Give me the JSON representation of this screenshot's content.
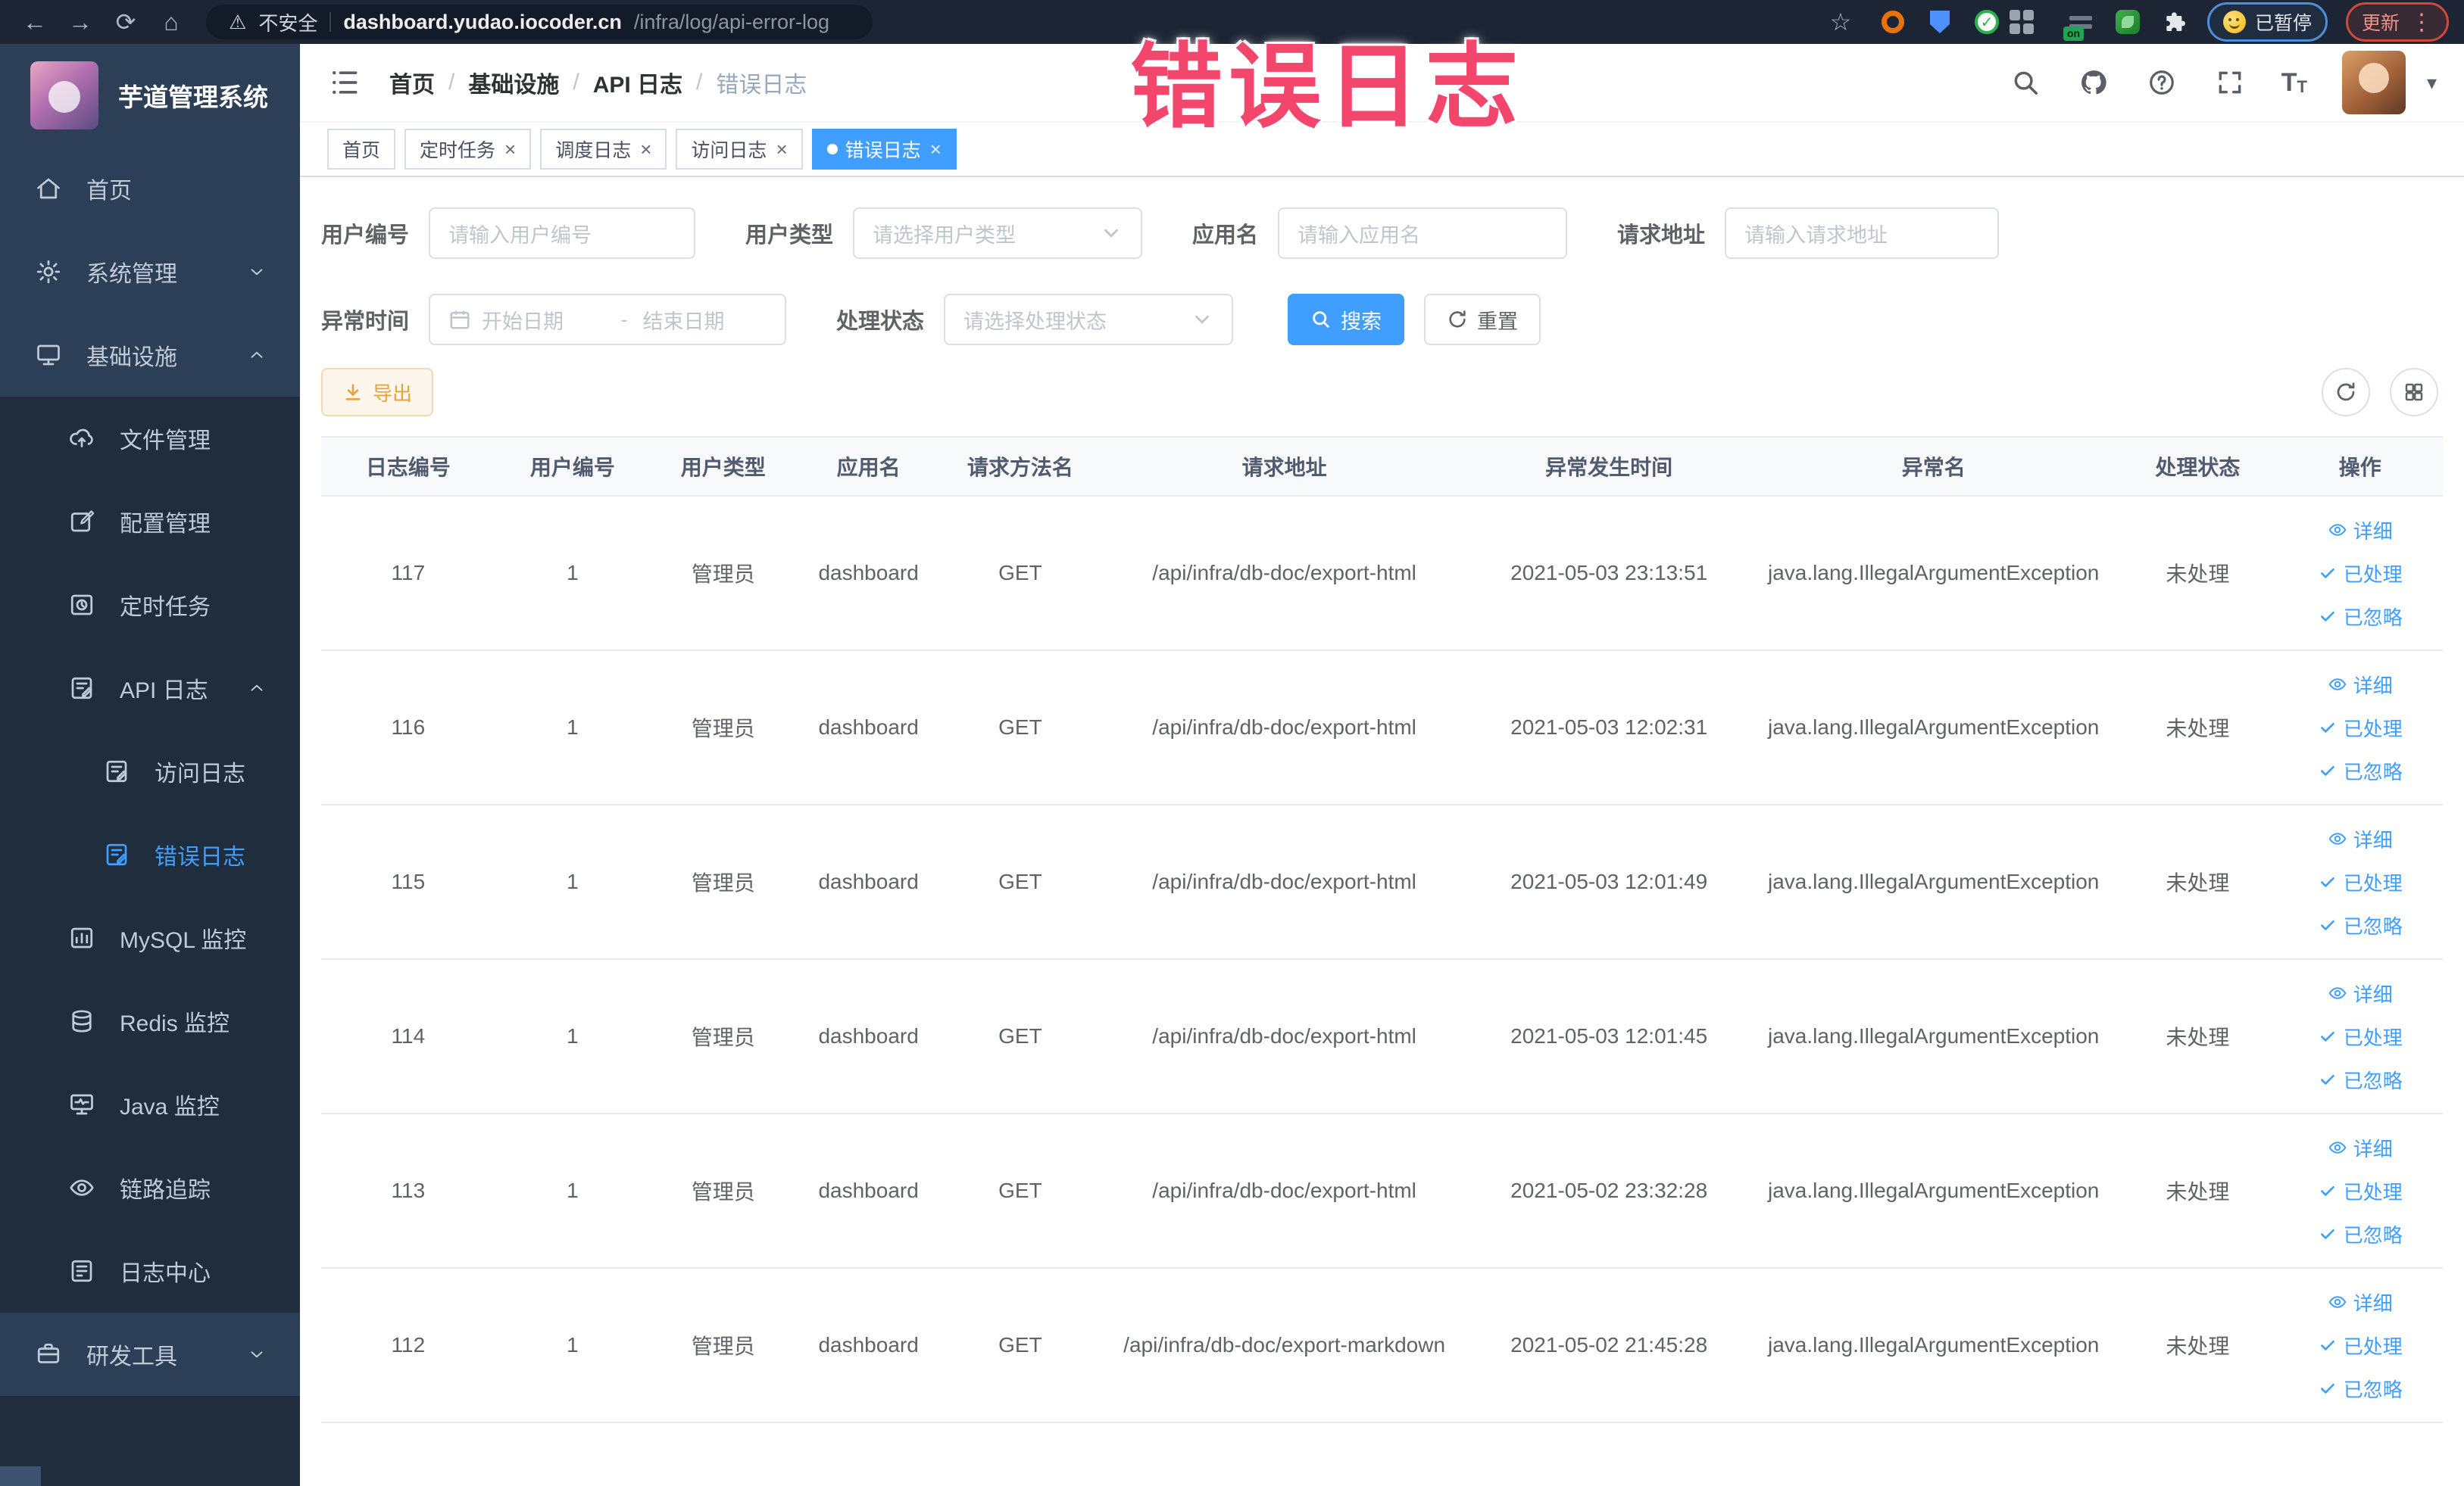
{
  "browser": {
    "security_label": "不安全",
    "url_domain": "dashboard.yudao.iocoder.cn",
    "url_path": "/infra/log/api-error-log",
    "extension_badge": "on",
    "paused_label": "已暂停",
    "update_label": "更新"
  },
  "annotation": {
    "text": "错误日志",
    "color": "#f2466c"
  },
  "sidebar": {
    "app_title": "芋道管理系统",
    "items": [
      {
        "label": "首页",
        "icon": "home-icon",
        "level": 0,
        "sub": false,
        "arrow": null,
        "active": false
      },
      {
        "label": "系统管理",
        "icon": "gear-icon",
        "level": 0,
        "sub": false,
        "arrow": "down",
        "active": false
      },
      {
        "label": "基础设施",
        "icon": "infrastructure-icon",
        "level": 0,
        "sub": false,
        "arrow": "up",
        "active": false
      },
      {
        "label": "文件管理",
        "icon": "file-upload-icon",
        "level": 1,
        "sub": true,
        "arrow": null,
        "active": false
      },
      {
        "label": "配置管理",
        "icon": "config-edit-icon",
        "level": 1,
        "sub": true,
        "arrow": null,
        "active": false
      },
      {
        "label": "定时任务",
        "icon": "schedule-icon",
        "level": 1,
        "sub": true,
        "arrow": null,
        "active": false
      },
      {
        "label": "API 日志",
        "icon": "api-log-icon",
        "level": 1,
        "sub": true,
        "arrow": "up",
        "active": false
      },
      {
        "label": "访问日志",
        "icon": "access-log-icon",
        "level": 2,
        "sub": true,
        "arrow": null,
        "active": false
      },
      {
        "label": "错误日志",
        "icon": "error-log-icon",
        "level": 2,
        "sub": true,
        "arrow": null,
        "active": true
      },
      {
        "label": "MySQL 监控",
        "icon": "mysql-monitor-icon",
        "level": 1,
        "sub": true,
        "arrow": null,
        "active": false
      },
      {
        "label": "Redis 监控",
        "icon": "redis-monitor-icon",
        "level": 1,
        "sub": true,
        "arrow": null,
        "active": false
      },
      {
        "label": "Java 监控",
        "icon": "java-monitor-icon",
        "level": 1,
        "sub": true,
        "arrow": null,
        "active": false
      },
      {
        "label": "链路追踪",
        "icon": "trace-eye-icon",
        "level": 1,
        "sub": true,
        "arrow": null,
        "active": false
      },
      {
        "label": "日志中心",
        "icon": "log-center-icon",
        "level": 1,
        "sub": true,
        "arrow": null,
        "active": false
      },
      {
        "label": "研发工具",
        "icon": "dev-tools-icon",
        "level": 0,
        "sub": false,
        "arrow": "down",
        "active": false
      }
    ]
  },
  "breadcrumb": {
    "items": [
      "首页",
      "基础设施",
      "API 日志",
      "错误日志"
    ]
  },
  "tabs": [
    {
      "label": "首页",
      "closable": false,
      "active": false
    },
    {
      "label": "定时任务",
      "closable": true,
      "active": false
    },
    {
      "label": "调度日志",
      "closable": true,
      "active": false
    },
    {
      "label": "访问日志",
      "closable": true,
      "active": false
    },
    {
      "label": "错误日志",
      "closable": true,
      "active": true
    }
  ],
  "filters": {
    "user_id": {
      "label": "用户编号",
      "placeholder": "请输入用户编号"
    },
    "user_type": {
      "label": "用户类型",
      "placeholder": "请选择用户类型"
    },
    "app_name": {
      "label": "应用名",
      "placeholder": "请输入应用名"
    },
    "request_url": {
      "label": "请求地址",
      "placeholder": "请输入请求地址"
    },
    "exception_time": {
      "label": "异常时间",
      "start_placeholder": "开始日期",
      "separator": "-",
      "end_placeholder": "结束日期"
    },
    "process_status": {
      "label": "处理状态",
      "placeholder": "请选择处理状态"
    },
    "search_label": "搜索",
    "reset_label": "重置"
  },
  "toolbar": {
    "export_label": "导出"
  },
  "table": {
    "columns": [
      "日志编号",
      "用户编号",
      "用户类型",
      "应用名",
      "请求方法名",
      "请求地址",
      "异常发生时间",
      "异常名",
      "处理状态",
      "操作"
    ],
    "actions": [
      {
        "label": "详细",
        "icon": "eye-icon"
      },
      {
        "label": "已处理",
        "icon": "check-icon"
      },
      {
        "label": "已忽略",
        "icon": "check-icon"
      }
    ],
    "rows": [
      {
        "id": "117",
        "user_id": "1",
        "user_type": "管理员",
        "app_name": "dashboard",
        "method": "GET",
        "url": "/api/infra/db-doc/export-html",
        "time": "2021-05-03 23:13:51",
        "exception": "java.lang.IllegalArgumentException",
        "status": "未处理"
      },
      {
        "id": "116",
        "user_id": "1",
        "user_type": "管理员",
        "app_name": "dashboard",
        "method": "GET",
        "url": "/api/infra/db-doc/export-html",
        "time": "2021-05-03 12:02:31",
        "exception": "java.lang.IllegalArgumentException",
        "status": "未处理"
      },
      {
        "id": "115",
        "user_id": "1",
        "user_type": "管理员",
        "app_name": "dashboard",
        "method": "GET",
        "url": "/api/infra/db-doc/export-html",
        "time": "2021-05-03 12:01:49",
        "exception": "java.lang.IllegalArgumentException",
        "status": "未处理"
      },
      {
        "id": "114",
        "user_id": "1",
        "user_type": "管理员",
        "app_name": "dashboard",
        "method": "GET",
        "url": "/api/infra/db-doc/export-html",
        "time": "2021-05-03 12:01:45",
        "exception": "java.lang.IllegalArgumentException",
        "status": "未处理"
      },
      {
        "id": "113",
        "user_id": "1",
        "user_type": "管理员",
        "app_name": "dashboard",
        "method": "GET",
        "url": "/api/infra/db-doc/export-html",
        "time": "2021-05-02 23:32:28",
        "exception": "java.lang.IllegalArgumentException",
        "status": "未处理"
      },
      {
        "id": "112",
        "user_id": "1",
        "user_type": "管理员",
        "app_name": "dashboard",
        "method": "GET",
        "url": "/api/infra/db-doc/export-markdown",
        "time": "2021-05-02 21:45:28",
        "exception": "java.lang.IllegalArgumentException",
        "status": "未处理"
      }
    ]
  },
  "colors": {
    "primary": "#409eff",
    "warning": "#e6a23c",
    "annotation": "#f2466c",
    "sidebar_bg": "#2d3f56",
    "sidebar_submenu_bg": "#1f2d3d",
    "chrome_bg": "#1d2534"
  }
}
